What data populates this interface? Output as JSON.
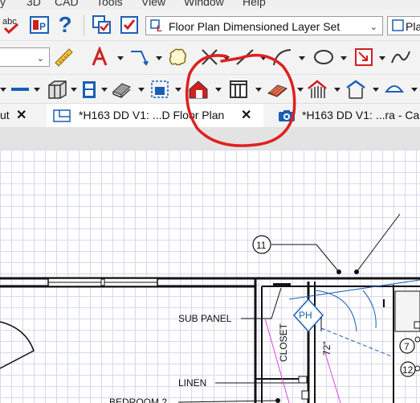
{
  "menu": {
    "items": [
      "y",
      "3D",
      "CAD",
      "Tools",
      "View",
      "Window",
      "Help"
    ]
  },
  "toolbar": {
    "spell_label": "abc",
    "help_label": "?",
    "layer_set": {
      "value": "Floor Plan Dimensioned Layer Set"
    },
    "plan_combo": {
      "value": "Pla"
    }
  },
  "tabs": [
    {
      "label": "ut"
    },
    {
      "label": "*H163 DD V1: ...D Floor Plan"
    },
    {
      "label": "*H163 DD V1: ...ra - Ca"
    }
  ],
  "plan": {
    "callout_11": "11",
    "sub_panel": "SUB PANEL",
    "ph": "PH",
    "closet": "CLOSET",
    "dim_72": "72\"",
    "linen": "LINEN",
    "bedroom": "BEDROOM 2",
    "callout_7": "7",
    "callout_12": "12"
  },
  "colors": {
    "annotation_red": "#e02020",
    "accent_blue": "#1a5fb4",
    "grid": "#d8d8ef"
  }
}
